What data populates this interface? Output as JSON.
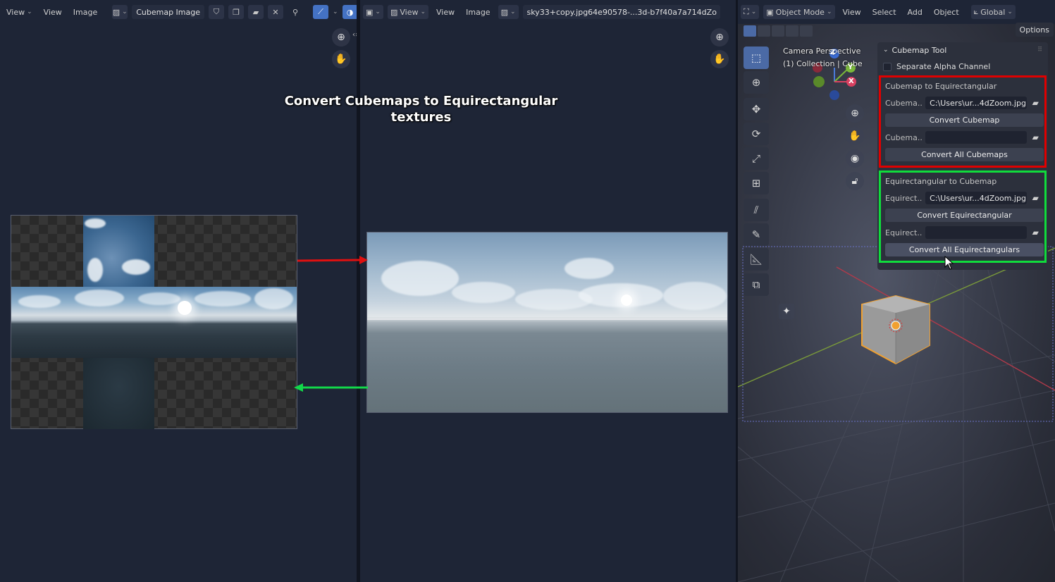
{
  "left_editor": {
    "header": {
      "view_menu": "View",
      "menu_view": "View",
      "menu_image": "Image",
      "image_name": "Cubemap Image"
    }
  },
  "mid_editor": {
    "header": {
      "menu_view_dropdown": "View",
      "menu_view": "View",
      "menu_image": "Image",
      "image_name": "sky33+copy.jpg64e90578-...3d-b7f40a7a714dZo"
    }
  },
  "overlay": {
    "title": "Convert Cubemaps to Equirectangular textures"
  },
  "right_editor": {
    "header": {
      "mode": "Object Mode",
      "menu_view": "View",
      "menu_select": "Select",
      "menu_add": "Add",
      "menu_object": "Object",
      "transform_orientation": "Global",
      "options": "Options"
    },
    "viewport": {
      "camera_label": "Camera Perspective",
      "collection_label": "(1) Collection | Cube",
      "axis_x": "X",
      "axis_y": "Y",
      "axis_z": "Z"
    },
    "panel": {
      "title": "Cubemap Tool",
      "separate_alpha": "Separate Alpha Channel",
      "cube_to_equi": {
        "title": "Cubemap to Equirectangular",
        "field1_label": "Cubema...",
        "field1_value": "C:\\Users\\ur...4dZoom.jpg",
        "convert_button": "Convert Cubemap",
        "field2_label": "Cubema...",
        "field2_value": "",
        "convert_all_button": "Convert All Cubemaps"
      },
      "equi_to_cube": {
        "title": "Equirectangular to Cubemap",
        "field1_label": "Equirect...",
        "field1_value": "C:\\Users\\ur...4dZoom.jpg",
        "convert_button": "Convert Equirectangular",
        "field2_label": "Equirect...",
        "field2_value": "",
        "convert_all_button": "Convert All Equirectangulars"
      }
    }
  },
  "colors": {
    "red_highlight": "#e00000",
    "green_highlight": "#10dc3c",
    "blue_accent": "#4472c4"
  }
}
